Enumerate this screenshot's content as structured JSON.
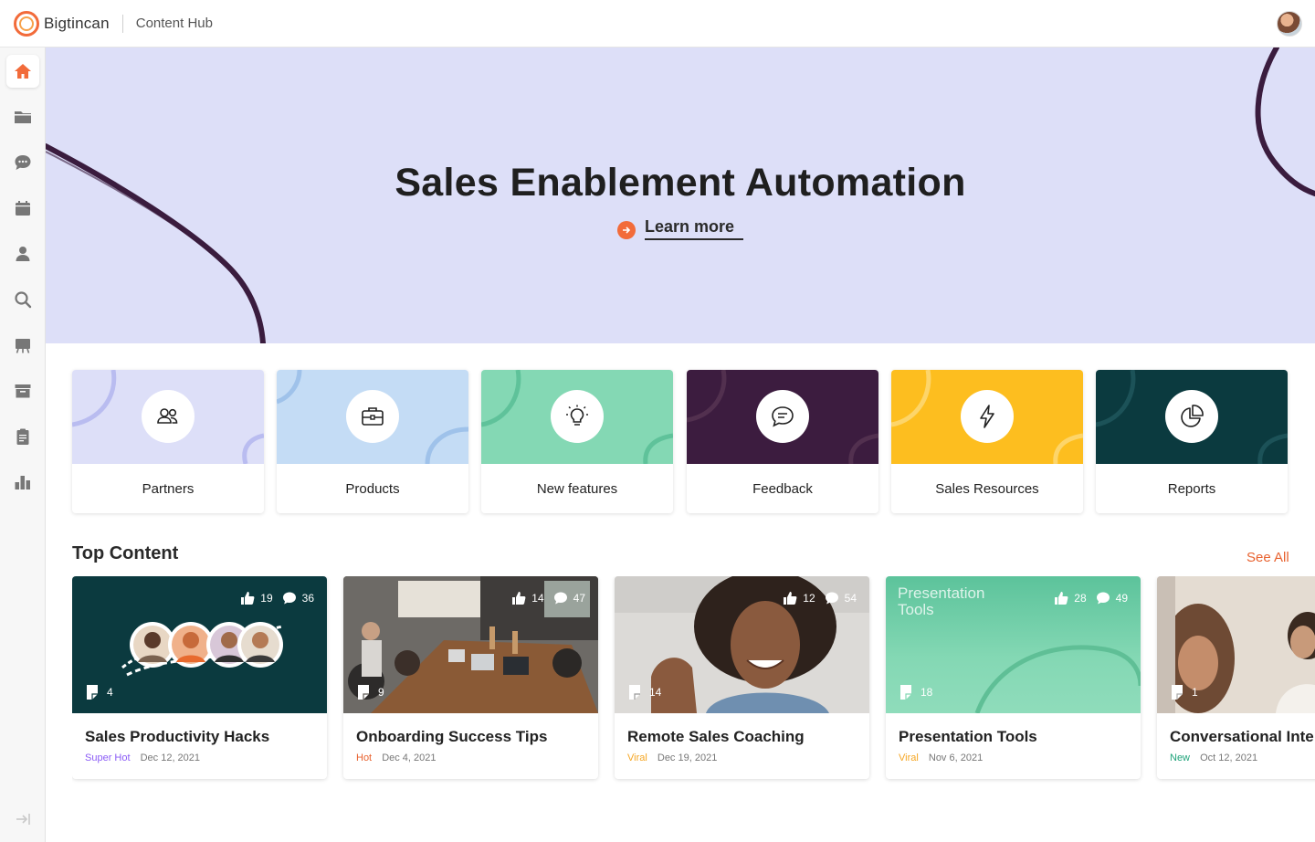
{
  "header": {
    "brand": "Bigtincan",
    "app_title": "Content Hub"
  },
  "sidebar": {
    "items": [
      {
        "icon": "home-icon",
        "active": true
      },
      {
        "icon": "folder-icon"
      },
      {
        "icon": "chat-icon"
      },
      {
        "icon": "calendar-icon"
      },
      {
        "icon": "user-icon"
      },
      {
        "icon": "search-icon"
      },
      {
        "icon": "presentation-icon"
      },
      {
        "icon": "archive-icon"
      },
      {
        "icon": "clipboard-icon"
      },
      {
        "icon": "analytics-icon"
      }
    ],
    "collapse_icon": "collapse-icon"
  },
  "hero": {
    "title": "Sales Enablement Automation",
    "link": "Learn more",
    "background": "#dddff8",
    "accent": "#f26b3a"
  },
  "categories": [
    {
      "label": "Partners",
      "icon": "partners-icon",
      "color": "#dddff8"
    },
    {
      "label": "Products",
      "icon": "briefcase-icon",
      "color": "#c4dcf5"
    },
    {
      "label": "New features",
      "icon": "lightbulb-icon",
      "color": "#84d8b4"
    },
    {
      "label": "Feedback",
      "icon": "message-icon",
      "color": "#3c1c3f"
    },
    {
      "label": "Sales Resources",
      "icon": "lightning-icon",
      "color": "#fdbe1f"
    },
    {
      "label": "Reports",
      "icon": "pie-chart-icon",
      "color": "#0b3a3f"
    }
  ],
  "top_content": {
    "title": "Top Content",
    "see_all": "See All",
    "cards": [
      {
        "title": "Sales Productivity Hacks",
        "tag": "Super Hot",
        "tag_color": "#8b5cf6",
        "date": "Dec 12, 2021",
        "likes": "19",
        "comments": "36",
        "pages": "4"
      },
      {
        "title": "Onboarding Success Tips",
        "tag": "Hot",
        "tag_color": "#e8622f",
        "date": "Dec 4, 2021",
        "likes": "14",
        "comments": "47",
        "pages": "9"
      },
      {
        "title": "Remote Sales Coaching",
        "tag": "Viral",
        "tag_color": "#f5a623",
        "date": "Dec 19, 2021",
        "likes": "12",
        "comments": "54",
        "pages": "14"
      },
      {
        "title": "Presentation Tools",
        "tag": "Viral",
        "tag_color": "#f5a623",
        "date": "Nov 6, 2021",
        "likes": "28",
        "comments": "49",
        "pages": "18",
        "thumb_title": "Presentation Tools"
      },
      {
        "title": "Conversational Inte",
        "tag": "New",
        "tag_color": "#1fa37a",
        "date": "Oct 12, 2021",
        "pages": "1"
      }
    ]
  }
}
